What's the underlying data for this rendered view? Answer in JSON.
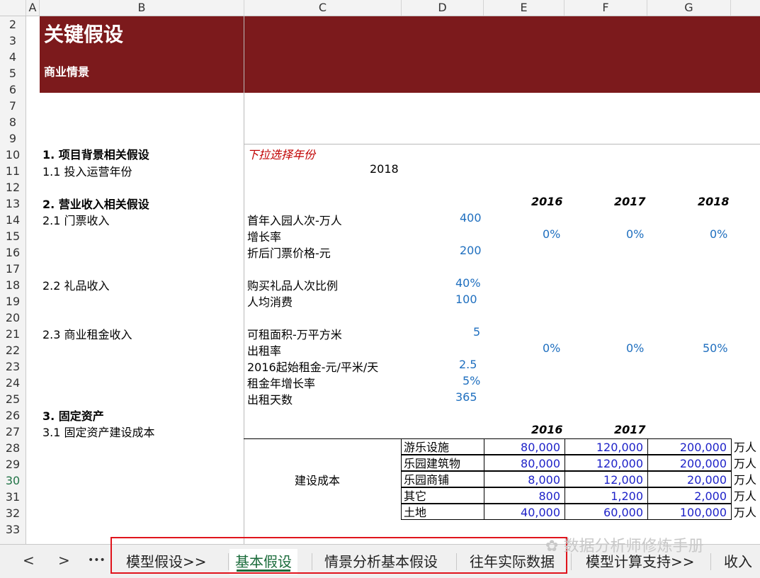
{
  "columns": [
    "A",
    "B",
    "C",
    "D",
    "E",
    "F",
    "G"
  ],
  "rows": [
    "2",
    "3",
    "4",
    "5",
    "6",
    "7",
    "8",
    "9",
    "10",
    "11",
    "12",
    "13",
    "14",
    "15",
    "16",
    "17",
    "18",
    "19",
    "20",
    "21",
    "22",
    "23",
    "24",
    "25",
    "26",
    "27",
    "28",
    "29",
    "30",
    "31",
    "32",
    "33"
  ],
  "selected_row": "30",
  "banner": {
    "title": "关键假设",
    "subtitle": "商业情景"
  },
  "hint": "下拉选择年份",
  "section1": {
    "title": "1. 项目背景相关假设",
    "item": "1.1 投入运营年份",
    "year_value": "2018"
  },
  "section2": {
    "title": "2. 营业收入相关假设",
    "years": [
      "2016",
      "2017",
      "2018"
    ],
    "ticket": {
      "label": "2.1 门票收入",
      "rows": [
        {
          "name": "首年入园人次-万人",
          "value": "400",
          "by_year": [
            "",
            "",
            ""
          ]
        },
        {
          "name": "增长率",
          "value": "",
          "by_year": [
            "0%",
            "0%",
            "0%"
          ]
        },
        {
          "name": "折后门票价格-元",
          "value": "200",
          "by_year": [
            "",
            "",
            ""
          ]
        }
      ]
    },
    "gift": {
      "label": "2.2 礼品收入",
      "rows": [
        {
          "name": "购买礼品人次比例",
          "value": "40%"
        },
        {
          "name": "人均消费",
          "value": "100"
        }
      ]
    },
    "rent": {
      "label": "2.3 商业租金收入",
      "rows": [
        {
          "name": "可租面积-万平方米",
          "value": "5",
          "by_year": [
            "",
            "",
            ""
          ]
        },
        {
          "name": "出租率",
          "value": "",
          "by_year": [
            "0%",
            "0%",
            "50%"
          ]
        },
        {
          "name": "2016起始租金-元/平米/天",
          "value": "2.5",
          "by_year": [
            "",
            "",
            ""
          ]
        },
        {
          "name": "租金年增长率",
          "value": "5%",
          "by_year": [
            "",
            "",
            ""
          ]
        },
        {
          "name": "出租天数",
          "value": "365",
          "by_year": [
            "",
            "",
            ""
          ]
        }
      ]
    }
  },
  "section3": {
    "title": "3. 固定资产",
    "item": "3.1 固定资产建设成本",
    "years": [
      "2016",
      "2017"
    ],
    "group_label": "建设成本",
    "unit": "万人",
    "rows": [
      {
        "name": "游乐设施",
        "values": [
          "80,000",
          "120,000",
          "200,000"
        ]
      },
      {
        "name": "乐园建筑物",
        "values": [
          "80,000",
          "120,000",
          "200,000"
        ]
      },
      {
        "name": "乐园商铺",
        "values": [
          "8,000",
          "12,000",
          "20,000"
        ]
      },
      {
        "name": "其它",
        "values": [
          "800",
          "1,200",
          "2,000"
        ]
      },
      {
        "name": "土地",
        "values": [
          "40,000",
          "60,000",
          "100,000"
        ]
      }
    ]
  },
  "tabs": {
    "nav_prev": "<",
    "nav_next": ">",
    "nav_more": "•••",
    "items": [
      "模型假设>>",
      "基本假设",
      "情景分析基本假设",
      "往年实际数据",
      "模型计算支持>>",
      "收入"
    ],
    "active": "基本假设"
  },
  "watermark": "数据分析师修炼手册",
  "colors": {
    "banner": "#7c1a1c",
    "input_blue": "#1f6fbf",
    "navy": "#1e22c8",
    "hint_red": "#c00000",
    "tab_green": "#1a6b3a",
    "highlight_box": "#e0141c"
  }
}
